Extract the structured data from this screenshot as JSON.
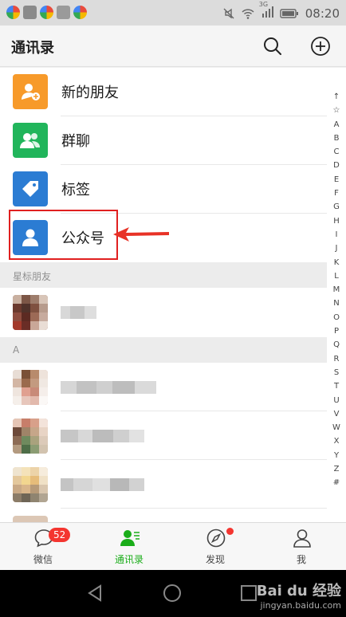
{
  "status_bar": {
    "time": "08:20",
    "network": "3G"
  },
  "header": {
    "title": "通讯录"
  },
  "features": [
    {
      "label": "新的朋友",
      "icon": "add-friend-icon",
      "color": "#f79a2a"
    },
    {
      "label": "群聊",
      "icon": "group-chat-icon",
      "color": "#21b55b"
    },
    {
      "label": "标签",
      "icon": "tag-icon",
      "color": "#2b7cd3"
    },
    {
      "label": "公众号",
      "icon": "official-account-icon",
      "color": "#2b7cd3"
    }
  ],
  "sections": [
    {
      "header": "星标朋友"
    },
    {
      "header": "A"
    }
  ],
  "index_letters": [
    "↑",
    "☆",
    "A",
    "B",
    "C",
    "D",
    "E",
    "F",
    "G",
    "H",
    "I",
    "J",
    "K",
    "L",
    "M",
    "N",
    "O",
    "P",
    "Q",
    "R",
    "S",
    "T",
    "U",
    "V",
    "W",
    "X",
    "Y",
    "Z",
    "#"
  ],
  "tabs": [
    {
      "label": "微信",
      "icon": "chat-bubble-icon",
      "badge": "52",
      "active": false
    },
    {
      "label": "通讯录",
      "icon": "contacts-icon",
      "active": true
    },
    {
      "label": "发现",
      "icon": "compass-icon",
      "active": false
    },
    {
      "label": "我",
      "icon": "person-icon",
      "active": false
    }
  ],
  "watermark": {
    "brand": "Bai du 经验",
    "url": "jingyan.baidu.com"
  },
  "colors": {
    "wechat_green": "#1aad19",
    "badge_red": "#f43530",
    "highlight_red": "#e02020"
  }
}
